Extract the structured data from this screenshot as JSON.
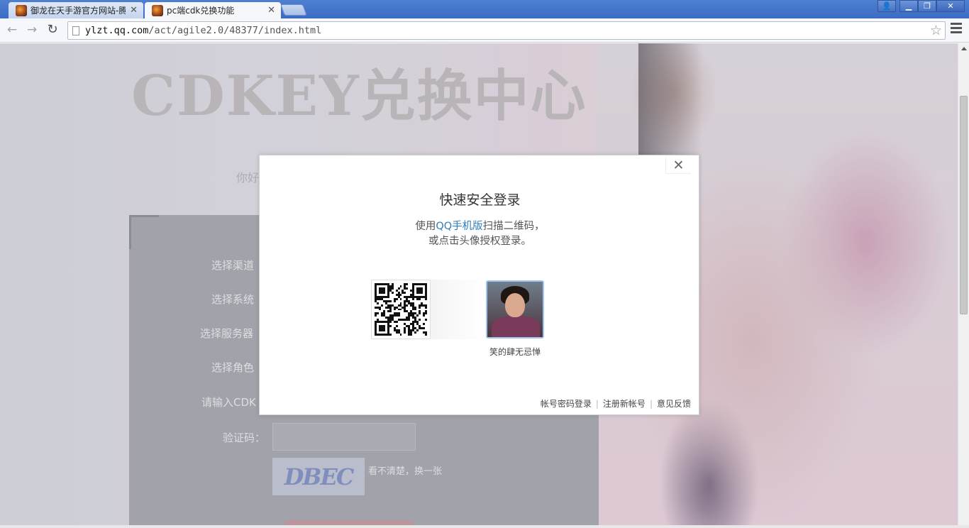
{
  "browser": {
    "tabs": [
      {
        "title": "御龙在天手游官方网站-腾",
        "active": false
      },
      {
        "title": "pc端cdk兑换功能",
        "active": true
      }
    ],
    "url_host": "ylzt.qq.com",
    "url_path": "/act/agile2.0/48377/index.html",
    "window_buttons": [
      "user",
      "minimize",
      "restore",
      "close"
    ]
  },
  "page": {
    "title": "CDKEY兑换中心",
    "greeting": "你好",
    "form": {
      "labels": [
        "选择渠道",
        "选择系统",
        "选择服务器",
        "选择角色",
        "请输入CDK",
        "验证码："
      ],
      "captcha_text": "DBEC",
      "captcha_refresh": "看不清楚，换一张"
    }
  },
  "dialog": {
    "title": "快速安全登录",
    "desc_prefix": "使用",
    "desc_link": "QQ手机版",
    "desc_suffix": "扫描二维码，",
    "desc_line2": "或点击头像授权登录。",
    "avatar_name": "笑的肆无忌惮",
    "footer": {
      "password_login": "帐号密码登录",
      "register": "注册新帐号",
      "feedback": "意见反馈"
    }
  }
}
